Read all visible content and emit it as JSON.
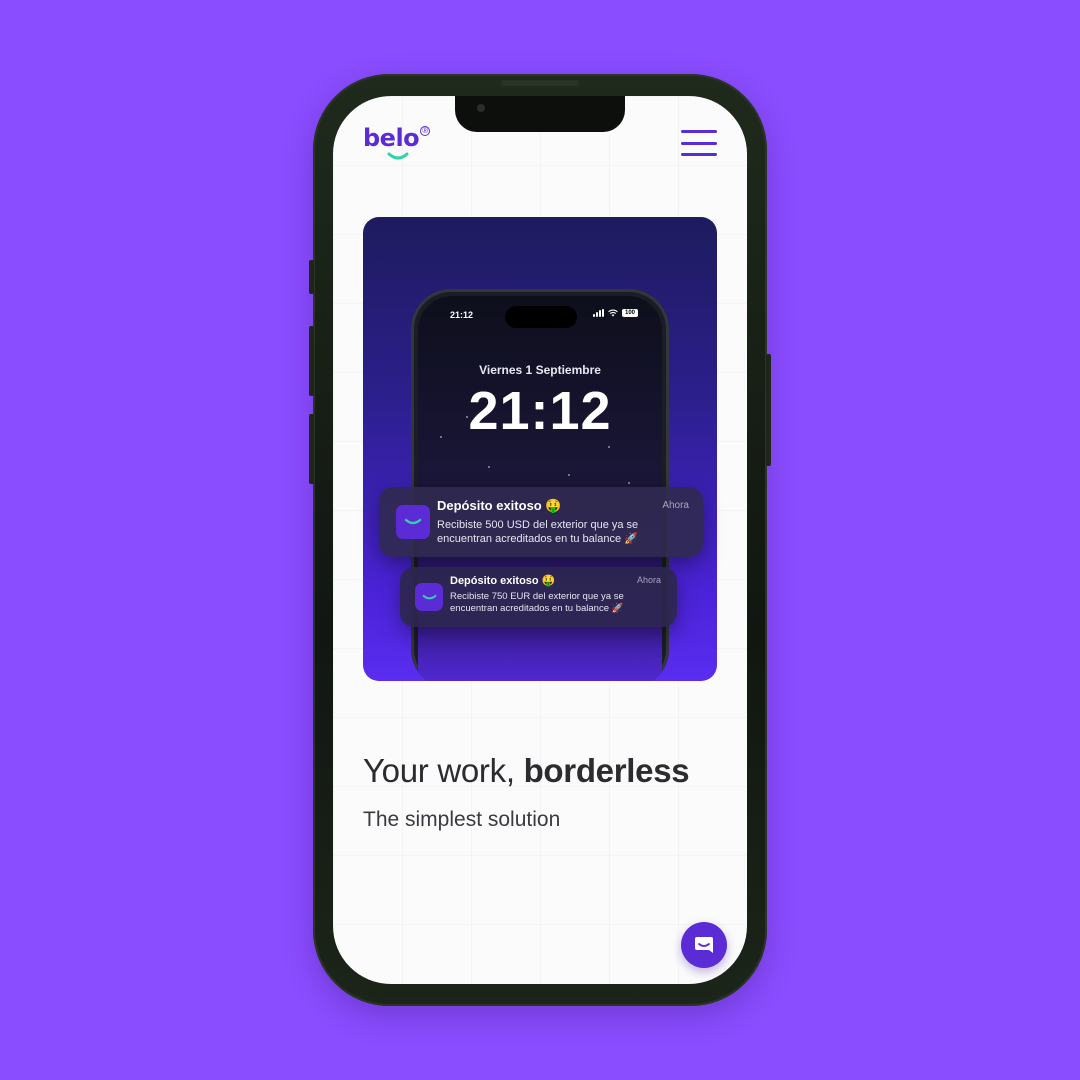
{
  "brand": {
    "name": "belo",
    "registered_mark": "®",
    "accent_color": "#5b2bd6",
    "background_color": "#8a4dff"
  },
  "header": {
    "menu_icon": "hamburger-menu-icon"
  },
  "hero": {
    "lock_screen": {
      "status_time": "21:12",
      "battery_label": "100",
      "date": "Viernes 1 Septiembre",
      "clock": "21:12"
    },
    "notifications": [
      {
        "title": "Depósito exitoso 🤑",
        "time": "Ahora",
        "body": "Recibiste 500 USD del exterior que ya se encuentran acreditados en tu balance 🚀"
      },
      {
        "title": "Depósito exitoso 🤑",
        "time": "Ahora",
        "body": "Recibiste 750 EUR del exterior que ya se encuentran acreditados en tu balance 🚀"
      }
    ]
  },
  "main": {
    "headline_regular": "Your work, ",
    "headline_bold": "borderless",
    "subheadline": "The simplest solution"
  },
  "chat": {
    "icon": "chat-bubble-icon"
  }
}
